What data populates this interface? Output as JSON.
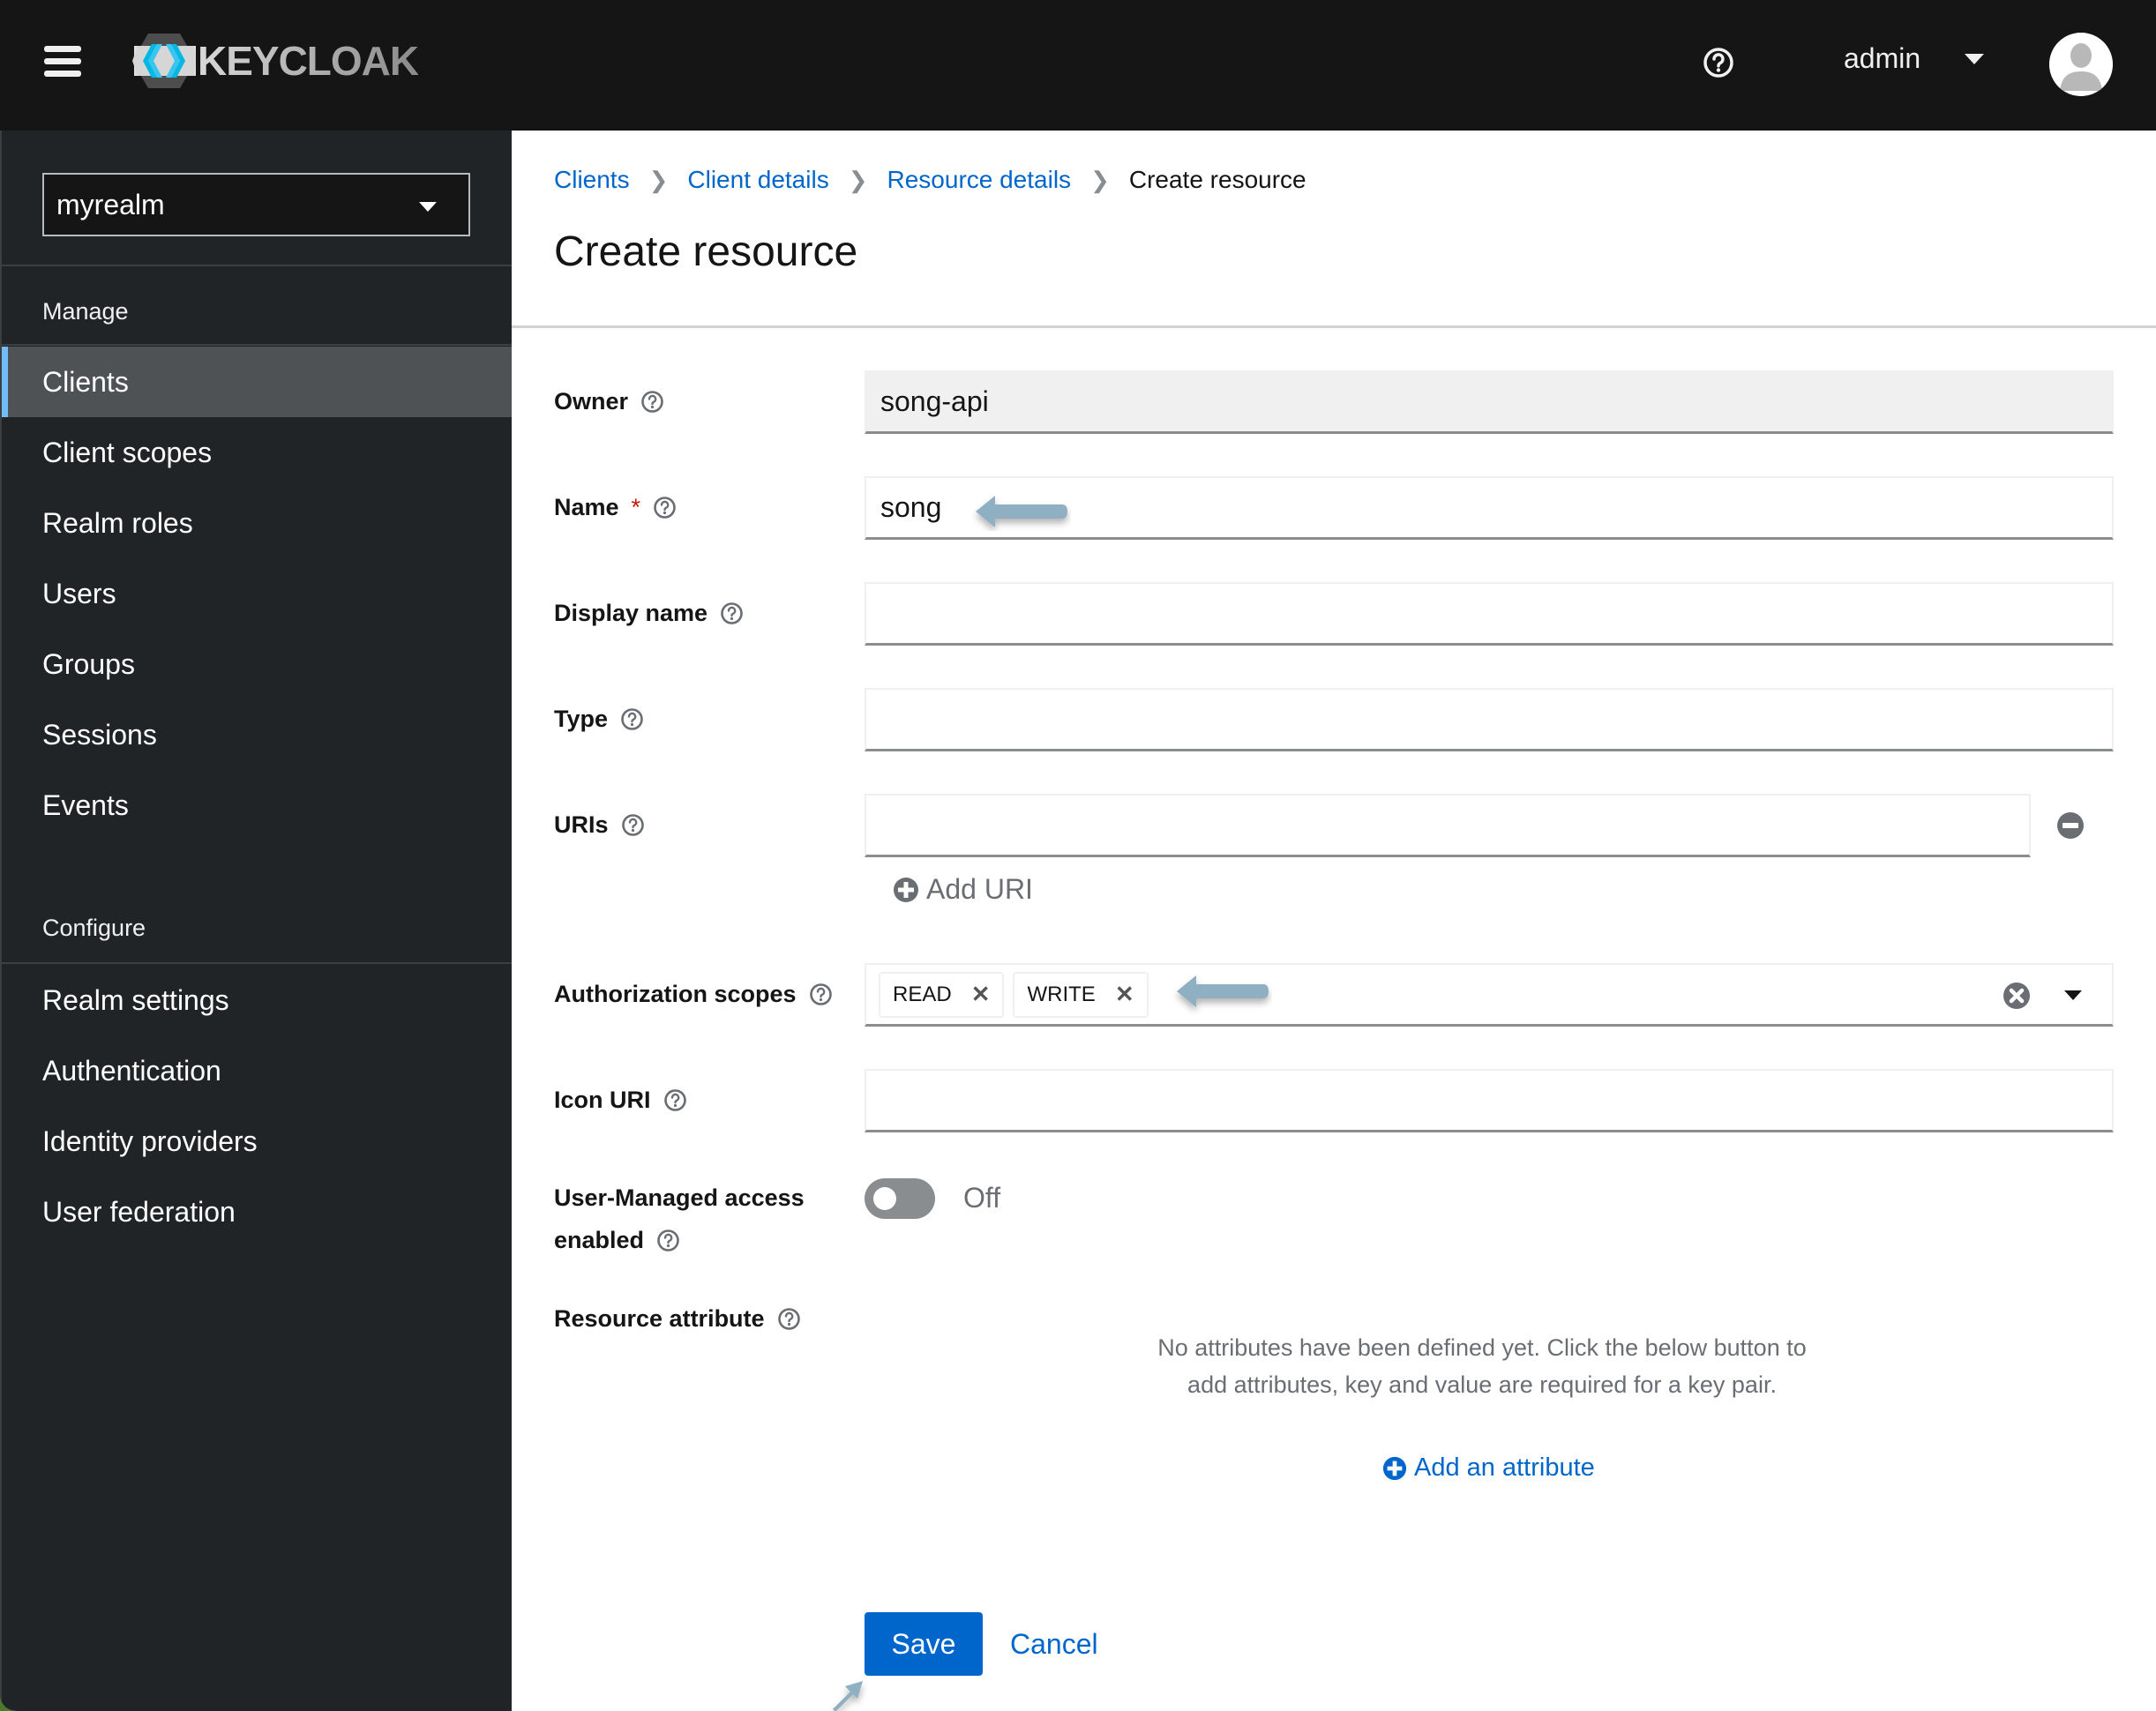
{
  "header": {
    "brand": "KEYCLOAK",
    "user_name": "admin",
    "icons": {
      "menu": "hamburger-icon",
      "help": "question-circle-icon",
      "user_caret": "caret-down-icon",
      "avatar": "user-avatar-icon"
    }
  },
  "sidebar": {
    "realm": "myrealm",
    "sections": [
      {
        "title": "Manage",
        "items": [
          {
            "label": "Clients",
            "active": true
          },
          {
            "label": "Client scopes"
          },
          {
            "label": "Realm roles"
          },
          {
            "label": "Users"
          },
          {
            "label": "Groups"
          },
          {
            "label": "Sessions"
          },
          {
            "label": "Events"
          }
        ]
      },
      {
        "title": "Configure",
        "items": [
          {
            "label": "Realm settings"
          },
          {
            "label": "Authentication"
          },
          {
            "label": "Identity providers"
          },
          {
            "label": "User federation"
          }
        ]
      }
    ]
  },
  "breadcrumb": [
    {
      "label": "Clients",
      "link": true
    },
    {
      "label": "Client details",
      "link": true
    },
    {
      "label": "Resource details",
      "link": true
    },
    {
      "label": "Create resource",
      "link": false
    }
  ],
  "page": {
    "title": "Create resource"
  },
  "form": {
    "owner": {
      "label": "Owner",
      "value": "song-api",
      "readonly": true
    },
    "name": {
      "label": "Name",
      "required_marker": "*",
      "value": "song"
    },
    "display_name": {
      "label": "Display name",
      "value": ""
    },
    "type": {
      "label": "Type",
      "value": ""
    },
    "uris": {
      "label": "URIs",
      "value": "",
      "add_label": "Add URI"
    },
    "authorization_scopes": {
      "label": "Authorization scopes",
      "chips": [
        "READ",
        "WRITE"
      ],
      "chip_remove_glyph": "✕"
    },
    "icon_uri": {
      "label": "Icon URI",
      "value": ""
    },
    "user_managed_access": {
      "label_line1": "User-Managed access",
      "label_line2": "enabled",
      "state_label": "Off",
      "enabled": false
    },
    "resource_attribute": {
      "label": "Resource attribute",
      "empty_message": "No attributes have been defined yet. Click the below button to add attributes, key and value are required for a key pair.",
      "add_label": "Add an attribute"
    }
  },
  "actions": {
    "save": "Save",
    "cancel": "Cancel"
  },
  "colors": {
    "primary": "#0066cc",
    "masthead": "#151515",
    "sidebar": "#212427",
    "active_nav": "#4f5255",
    "active_accent": "#73bcf7",
    "required": "#c9190b",
    "annotation_arrow": "#8fb0c2"
  }
}
